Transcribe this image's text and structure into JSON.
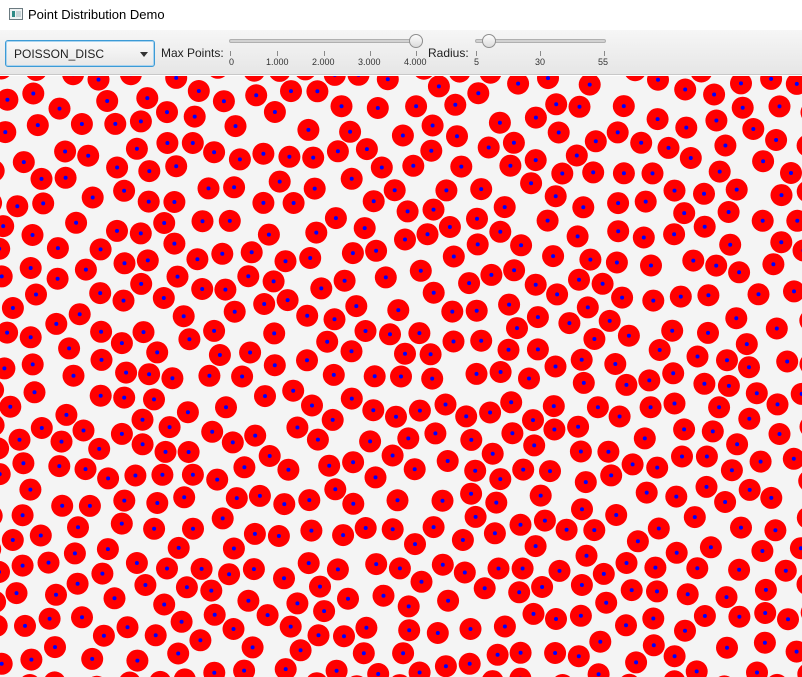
{
  "window": {
    "title": "Point Distribution Demo",
    "icon": "app-window-icon"
  },
  "toolbar": {
    "distribution_select": {
      "value": "POISSON_DISC"
    },
    "max_points": {
      "label": "Max Points:",
      "value": 4000,
      "min": 0,
      "max": 4000,
      "tick_labels": [
        "0",
        "1.000",
        "2.000",
        "3.000",
        "4.000"
      ]
    },
    "radius": {
      "label": "Radius:",
      "value": 10,
      "min": 5,
      "max": 55,
      "tick_labels": [
        "5",
        "30",
        "55"
      ]
    }
  },
  "canvas": {
    "point_fill": "#ff0000",
    "center_fill": "#0000ff",
    "background": "#f4f4f4"
  }
}
